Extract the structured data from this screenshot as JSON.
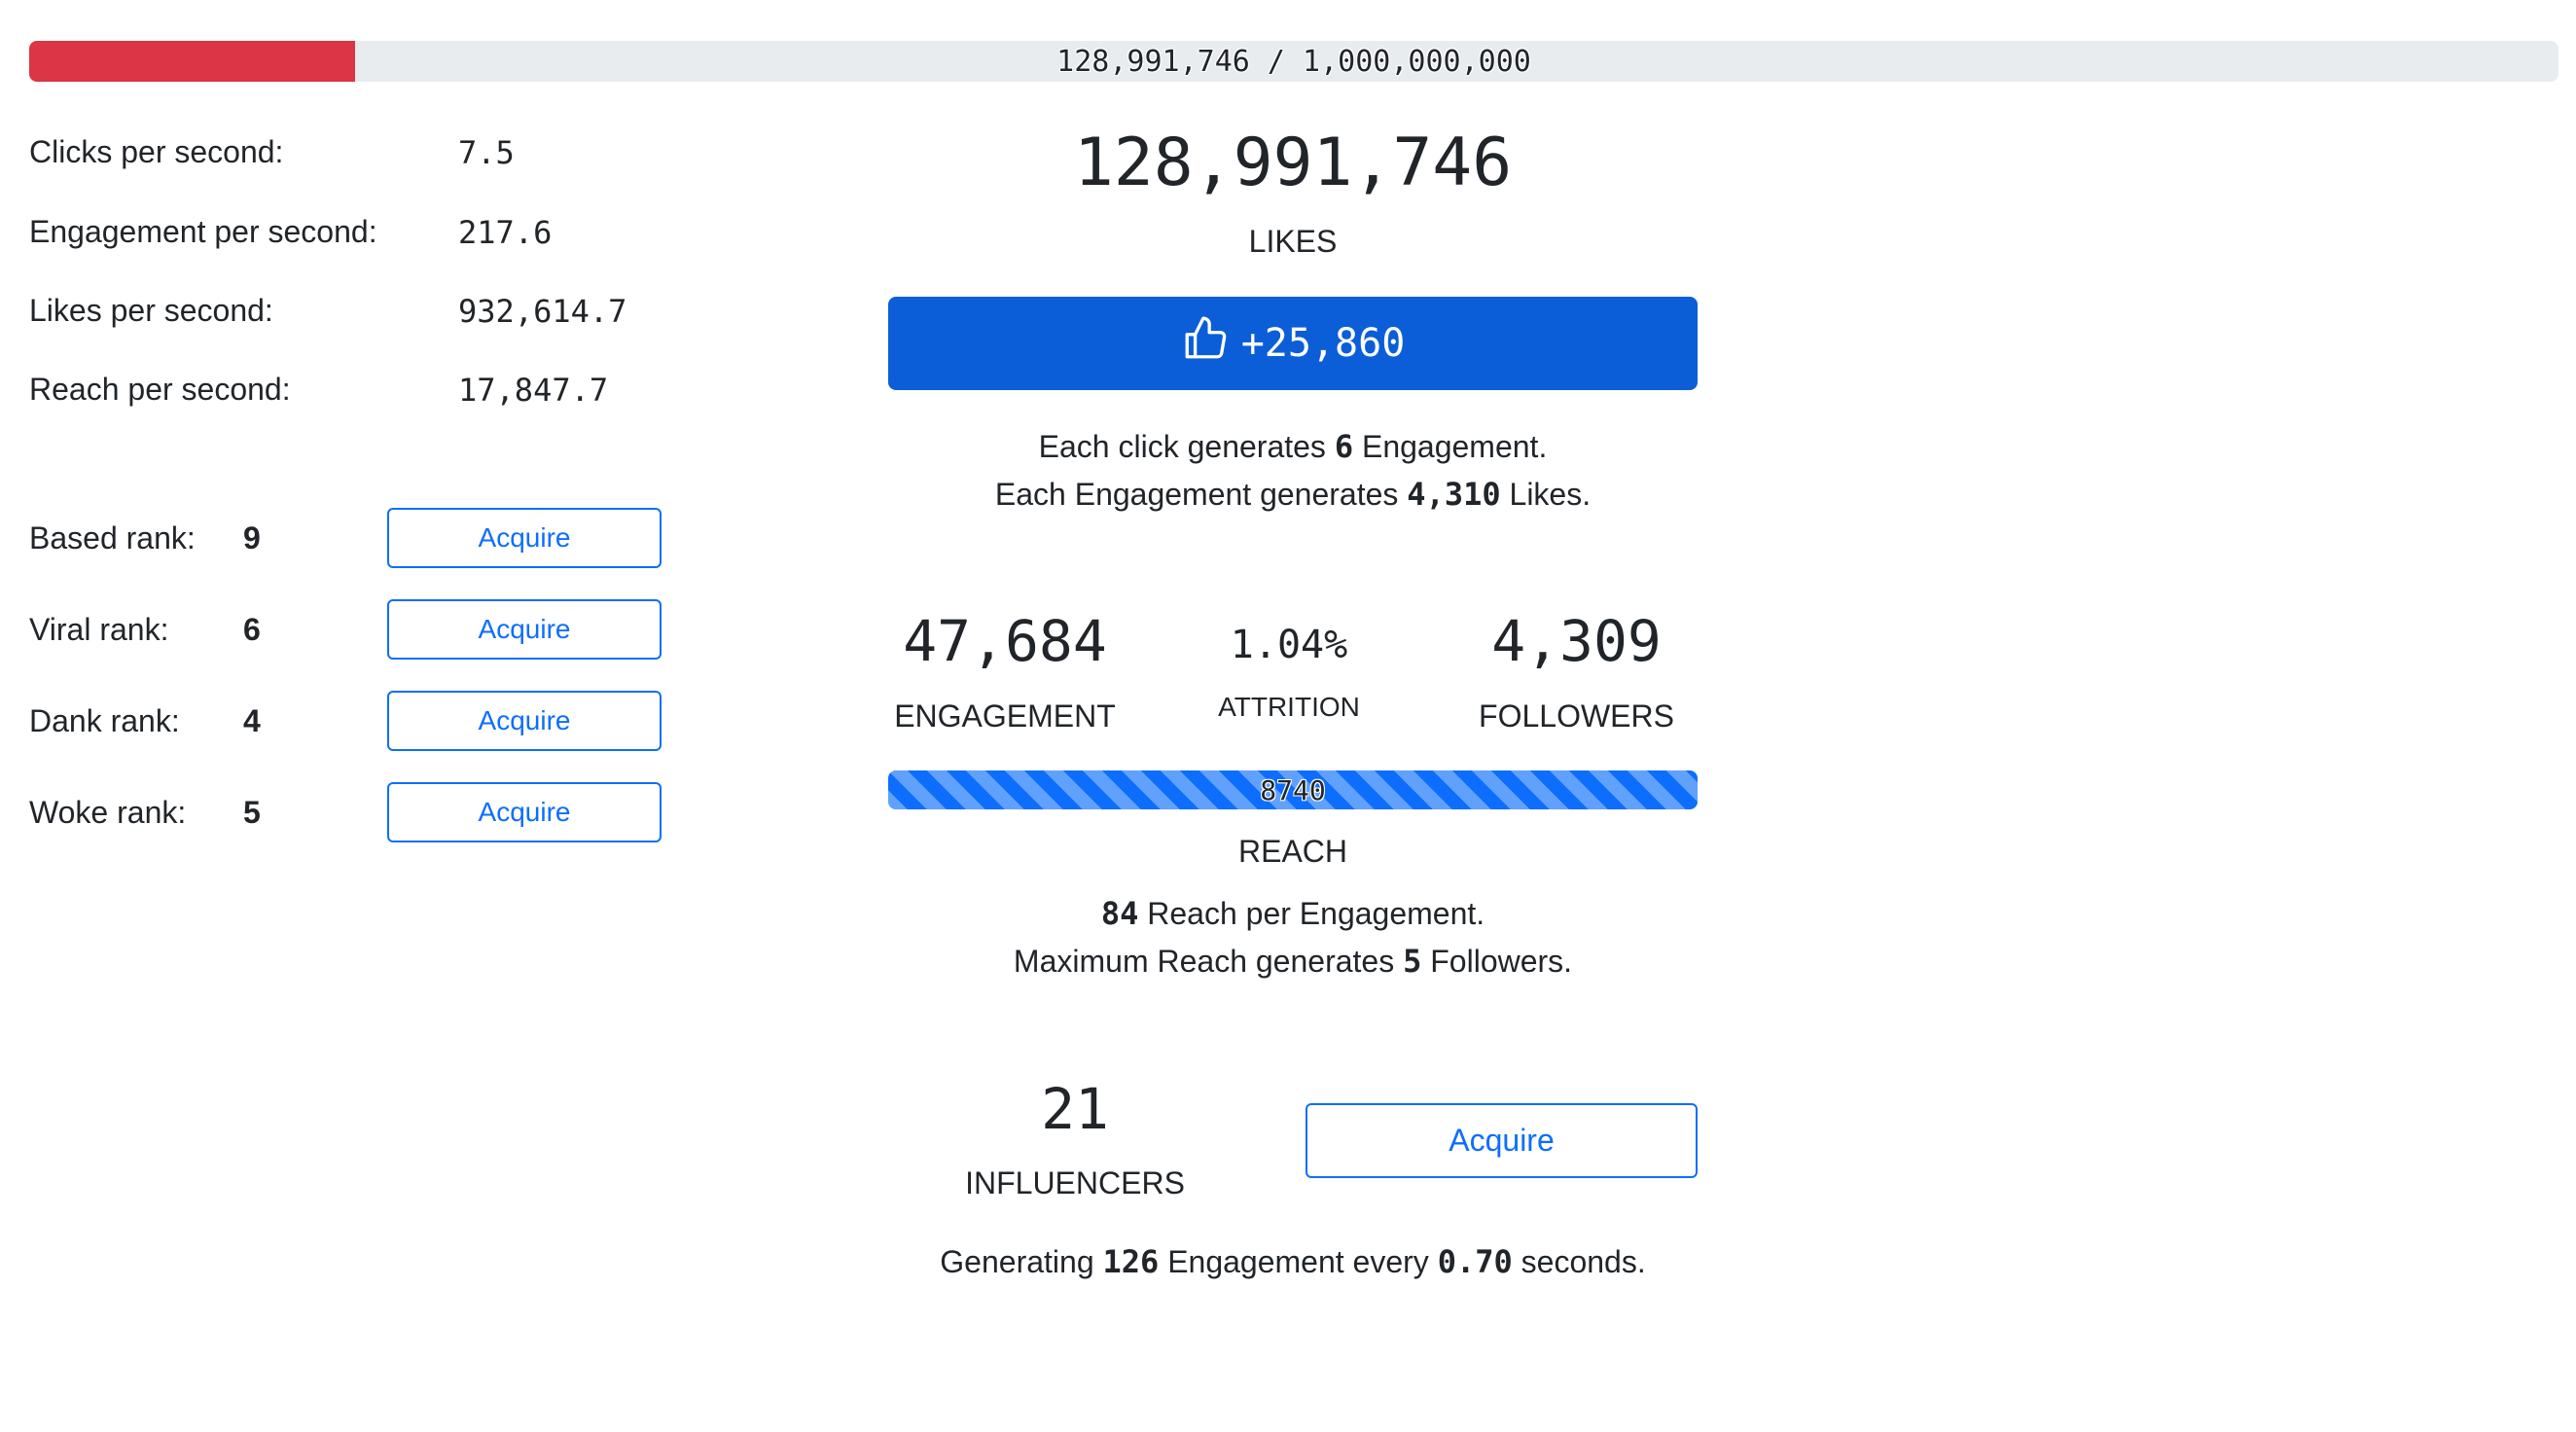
{
  "top_progress": {
    "text": "128,991,746 / 1,000,000,000",
    "fraction": 0.129,
    "fill_color": "#dc3545"
  },
  "rates": [
    {
      "label": "Clicks per second:",
      "value": "7.5"
    },
    {
      "label": "Engagement per second:",
      "value": "217.6"
    },
    {
      "label": "Likes per second:",
      "value": "932,614.7"
    },
    {
      "label": "Reach per second:",
      "value": "17,847.7"
    }
  ],
  "ranks": [
    {
      "label": "Based rank:",
      "value": "9",
      "button": "Acquire"
    },
    {
      "label": "Viral rank:",
      "value": "6",
      "button": "Acquire"
    },
    {
      "label": "Dank rank:",
      "value": "4",
      "button": "Acquire"
    },
    {
      "label": "Woke rank:",
      "value": "5",
      "button": "Acquire"
    }
  ],
  "likes": {
    "count": "128,991,746",
    "label": "LIKES"
  },
  "like_button": {
    "icon": "thumbs-up-icon",
    "label": "+25,860",
    "color": "#0b5ed7"
  },
  "click_info": {
    "line1_prefix": "Each click generates ",
    "line1_value": "6",
    "line1_suffix": " Engagement.",
    "line2_prefix": "Each Engagement generates ",
    "line2_value": "4,310",
    "line2_suffix": " Likes."
  },
  "engagement": {
    "value": "47,684",
    "label": "ENGAGEMENT"
  },
  "attrition": {
    "value": "1.04%",
    "label": "ATTRITION"
  },
  "followers": {
    "value": "4,309",
    "label": "FOLLOWERS"
  },
  "reach": {
    "bar_text": "8740",
    "fraction": 1.0,
    "label": "REACH"
  },
  "reach_info": {
    "line1_value": "84",
    "line1_suffix": " Reach per Engagement.",
    "line2_prefix": "Maximum Reach generates ",
    "line2_value": "5",
    "line2_suffix": " Followers."
  },
  "influencers": {
    "count": "21",
    "label": "INFLUENCERS",
    "button": "Acquire"
  },
  "generating": {
    "prefix": "Generating ",
    "engagement": "126",
    "middle": " Engagement every ",
    "seconds": "0.70",
    "suffix": " seconds."
  }
}
